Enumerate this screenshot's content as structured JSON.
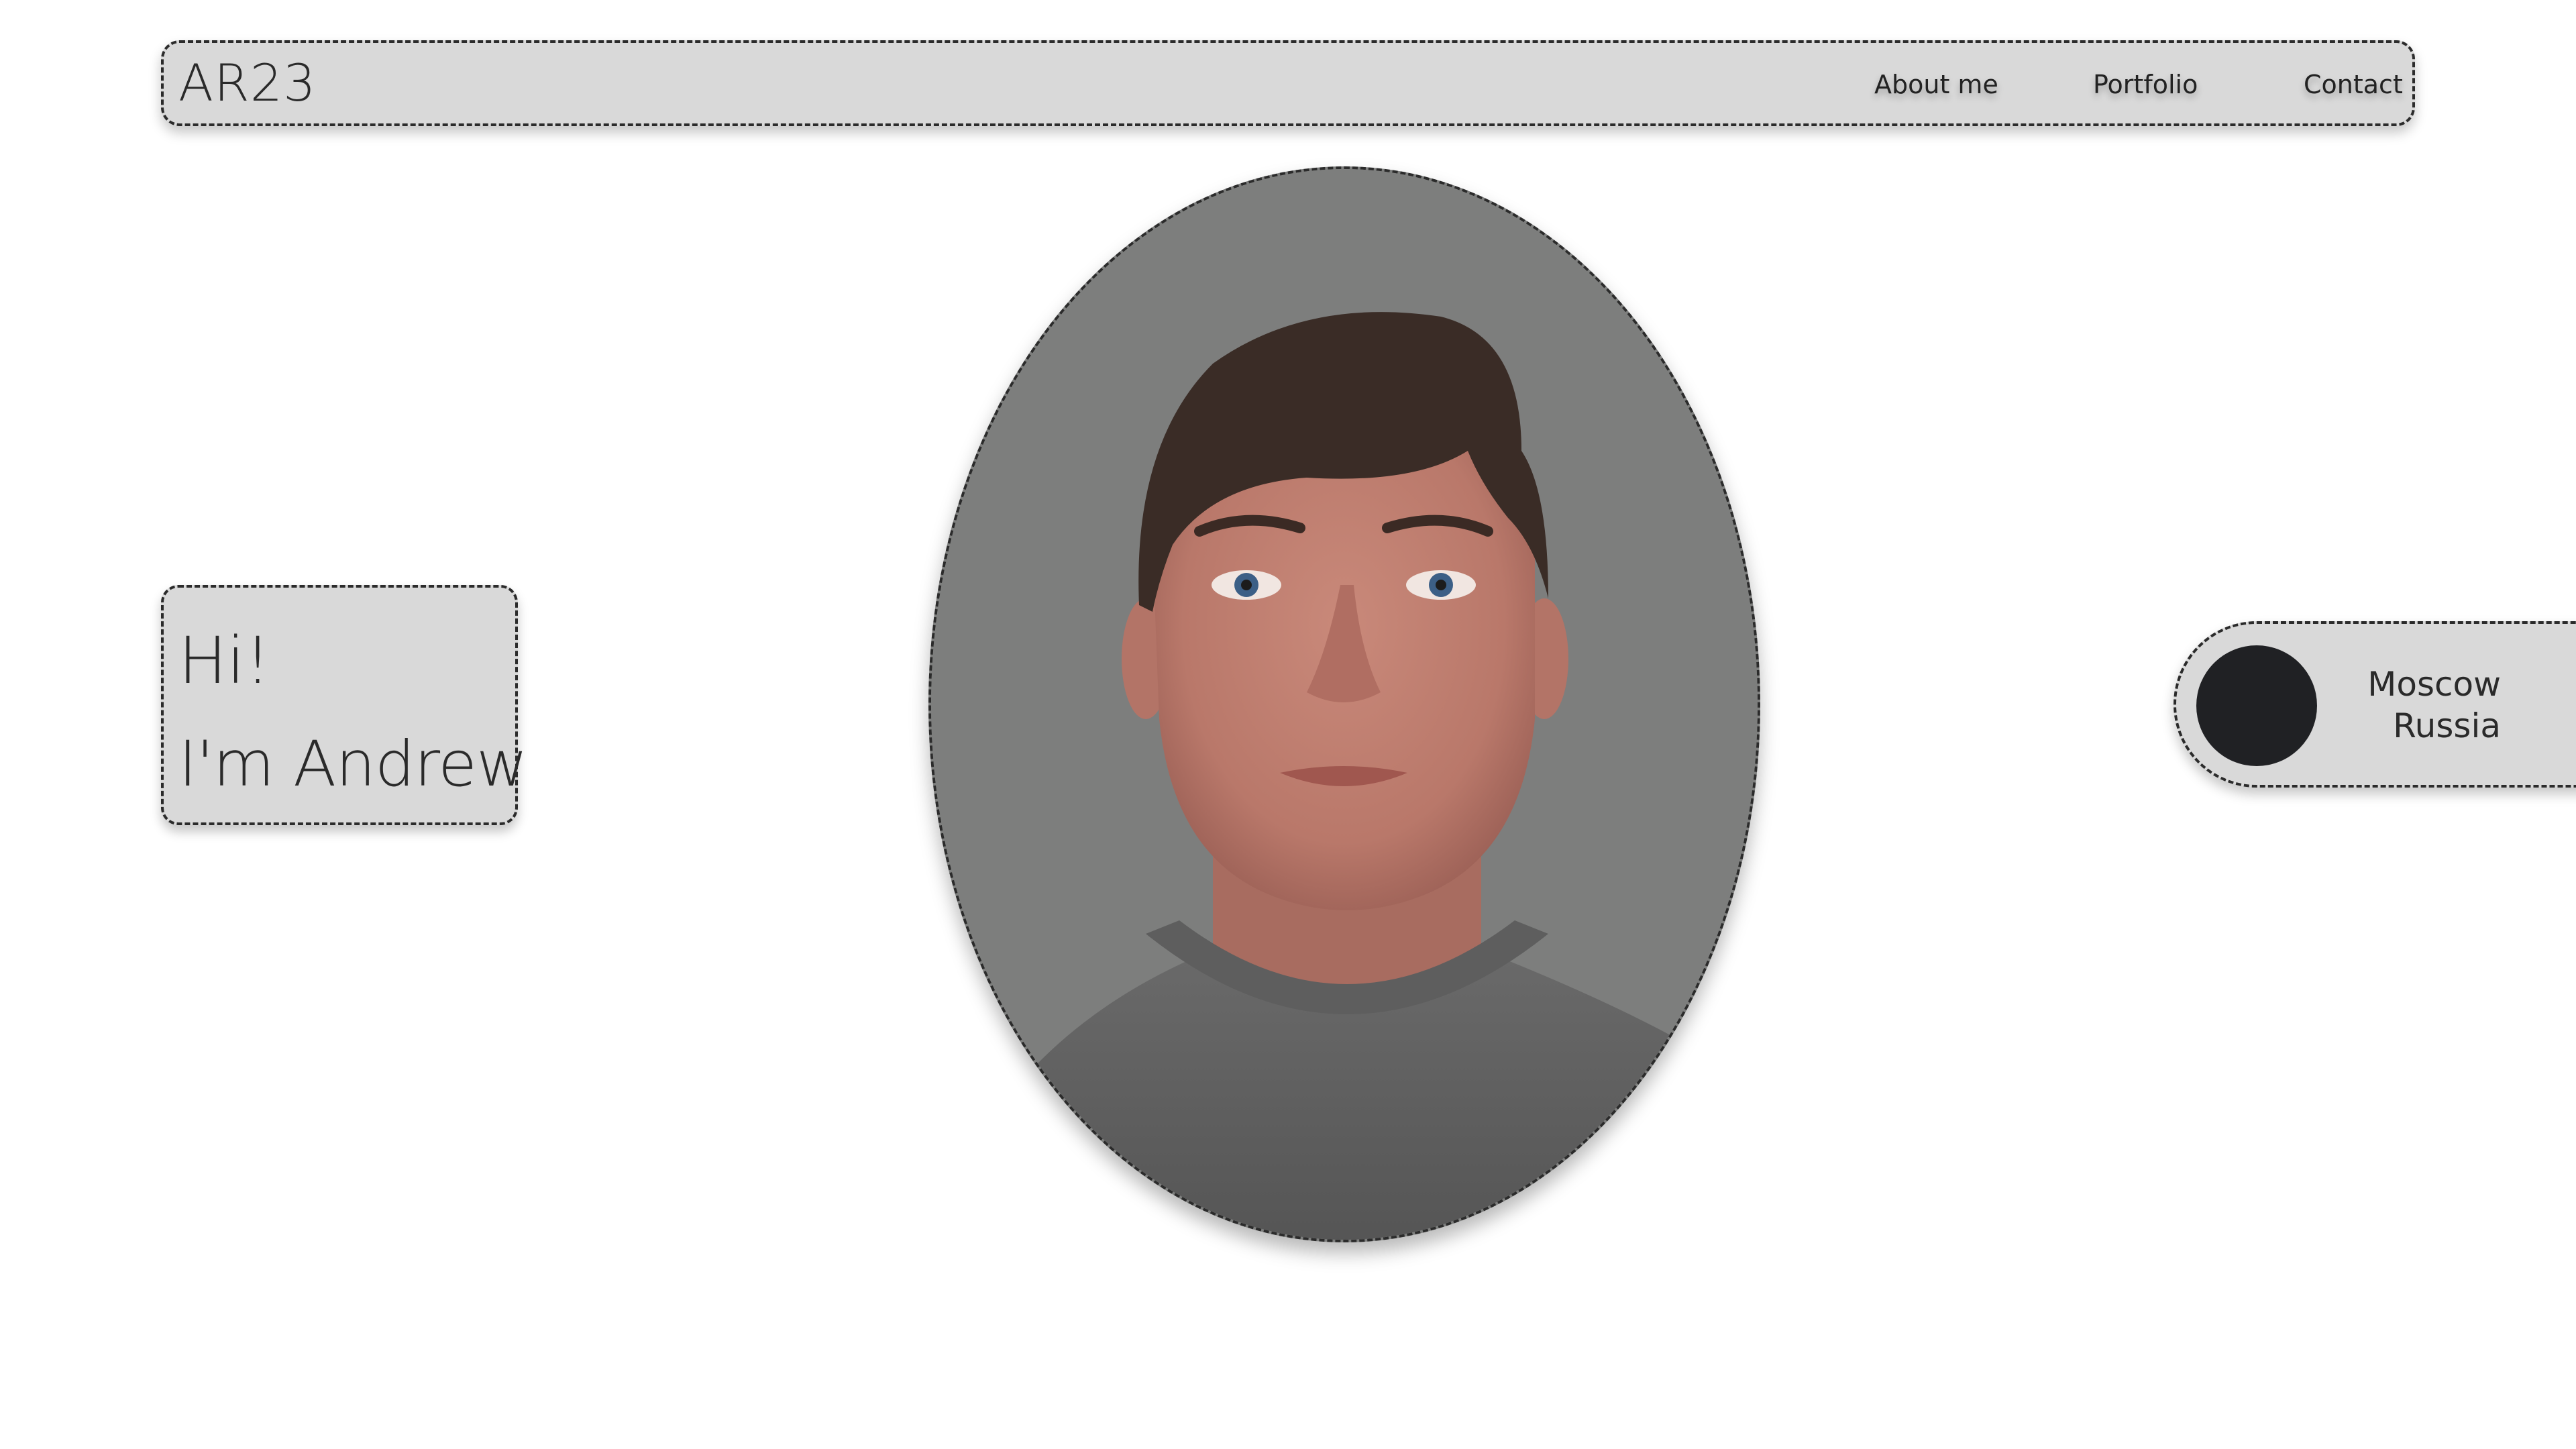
{
  "header": {
    "logo": "AR23",
    "nav": [
      "About me",
      "Portfolio",
      "Contact"
    ]
  },
  "hero": {
    "greeting_line1": "Hi!",
    "greeting_line2": "I'm Andrew"
  },
  "location": {
    "city": "Moscow",
    "country": "Russia"
  },
  "colors": {
    "card_bg": "#d9d9d9",
    "border": "#2b2b2b",
    "dot": "#202124",
    "photo_bg": "#7d7e7d",
    "page_bg": "#ffffff"
  }
}
